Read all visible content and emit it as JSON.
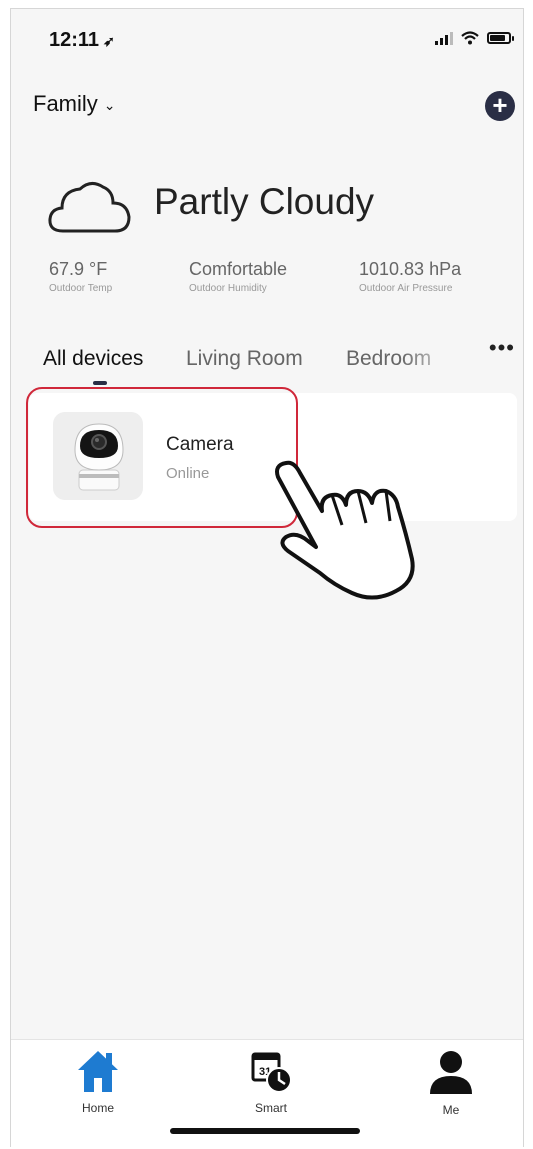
{
  "status_bar": {
    "time": "12:11",
    "location_icon": "location-arrow-icon",
    "icons": [
      "signal-icon",
      "wifi-icon",
      "battery-icon"
    ]
  },
  "header": {
    "home_name": "Family",
    "dropdown_icon": "chevron-down-icon",
    "add_icon": "plus-circle-icon"
  },
  "weather": {
    "icon": "cloud-icon",
    "condition": "Partly Cloudy",
    "stats": [
      {
        "value": "67.9 °F",
        "label": "Outdoor Temp"
      },
      {
        "value": "Comfortable",
        "label": "Outdoor Humidity"
      },
      {
        "value": "1010.83 hPa",
        "label": "Outdoor Air Pressure"
      }
    ]
  },
  "tabs": {
    "items": [
      "All devices",
      "Living Room",
      "Bedroom"
    ],
    "active": "All devices",
    "more_icon": "more-dots-icon"
  },
  "devices": [
    {
      "name": "Camera",
      "status": "Online",
      "icon": "security-camera-image"
    }
  ],
  "bottom_nav": [
    {
      "label": "Home",
      "icon": "home-icon",
      "active": true
    },
    {
      "label": "Smart",
      "icon": "calendar-clock-icon",
      "active": false
    },
    {
      "label": "Me",
      "icon": "person-icon",
      "active": false
    }
  ],
  "colors": {
    "accent": "#2a2e45",
    "home_active": "#1e7bd1",
    "highlight": "#d0283a",
    "background": "#f6f6f6"
  }
}
